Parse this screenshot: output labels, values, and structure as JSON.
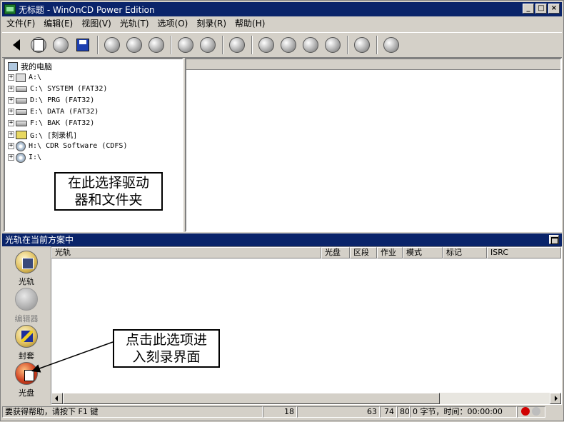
{
  "window": {
    "title": "无标题 - WinOnCD Power Edition"
  },
  "menu": [
    "文件(F)",
    "编辑(E)",
    "视图(V)",
    "光轨(T)",
    "选项(O)",
    "刻录(R)",
    "帮助(H)"
  ],
  "tree": {
    "root": "我的电脑",
    "items": [
      {
        "label": "A:\\",
        "icon": "floppy-icon"
      },
      {
        "label": "C:\\ SYSTEM (FAT32)",
        "icon": "drive-icon"
      },
      {
        "label": "D:\\ PRG (FAT32)",
        "icon": "drive-icon"
      },
      {
        "label": "E:\\ DATA (FAT32)",
        "icon": "drive-icon"
      },
      {
        "label": "F:\\ BAK (FAT32)",
        "icon": "drive-icon"
      },
      {
        "label": "G:\\ [刻录机]",
        "icon": "burner-icon"
      },
      {
        "label": "H:\\ CDR Software (CDFS)",
        "icon": "cdrom-icon"
      },
      {
        "label": "I:\\",
        "icon": "cdrom-icon"
      }
    ]
  },
  "annotations": {
    "drive_hint_line1": "在此选择驱动",
    "drive_hint_line2": "器和文件夹",
    "disc_hint_line1": "点击此选项进",
    "disc_hint_line2": "入刻录界面"
  },
  "lower_panel": {
    "title": "光轨在当前方案中",
    "sidebar": [
      {
        "label": "光轨",
        "enabled": true
      },
      {
        "label": "编辑器",
        "enabled": false
      },
      {
        "label": "封套",
        "enabled": true
      },
      {
        "label": "光盘",
        "enabled": true
      }
    ],
    "columns": [
      "光轨",
      "光盘",
      "区段",
      "作业",
      "模式",
      "标记",
      "ISRC"
    ]
  },
  "status": {
    "help": "要获得帮助，请按下 F1 键",
    "value1": "18",
    "value2": "63",
    "value3": "74",
    "value4": "80",
    "bytes": "0 字节，时间：00:00:00"
  }
}
